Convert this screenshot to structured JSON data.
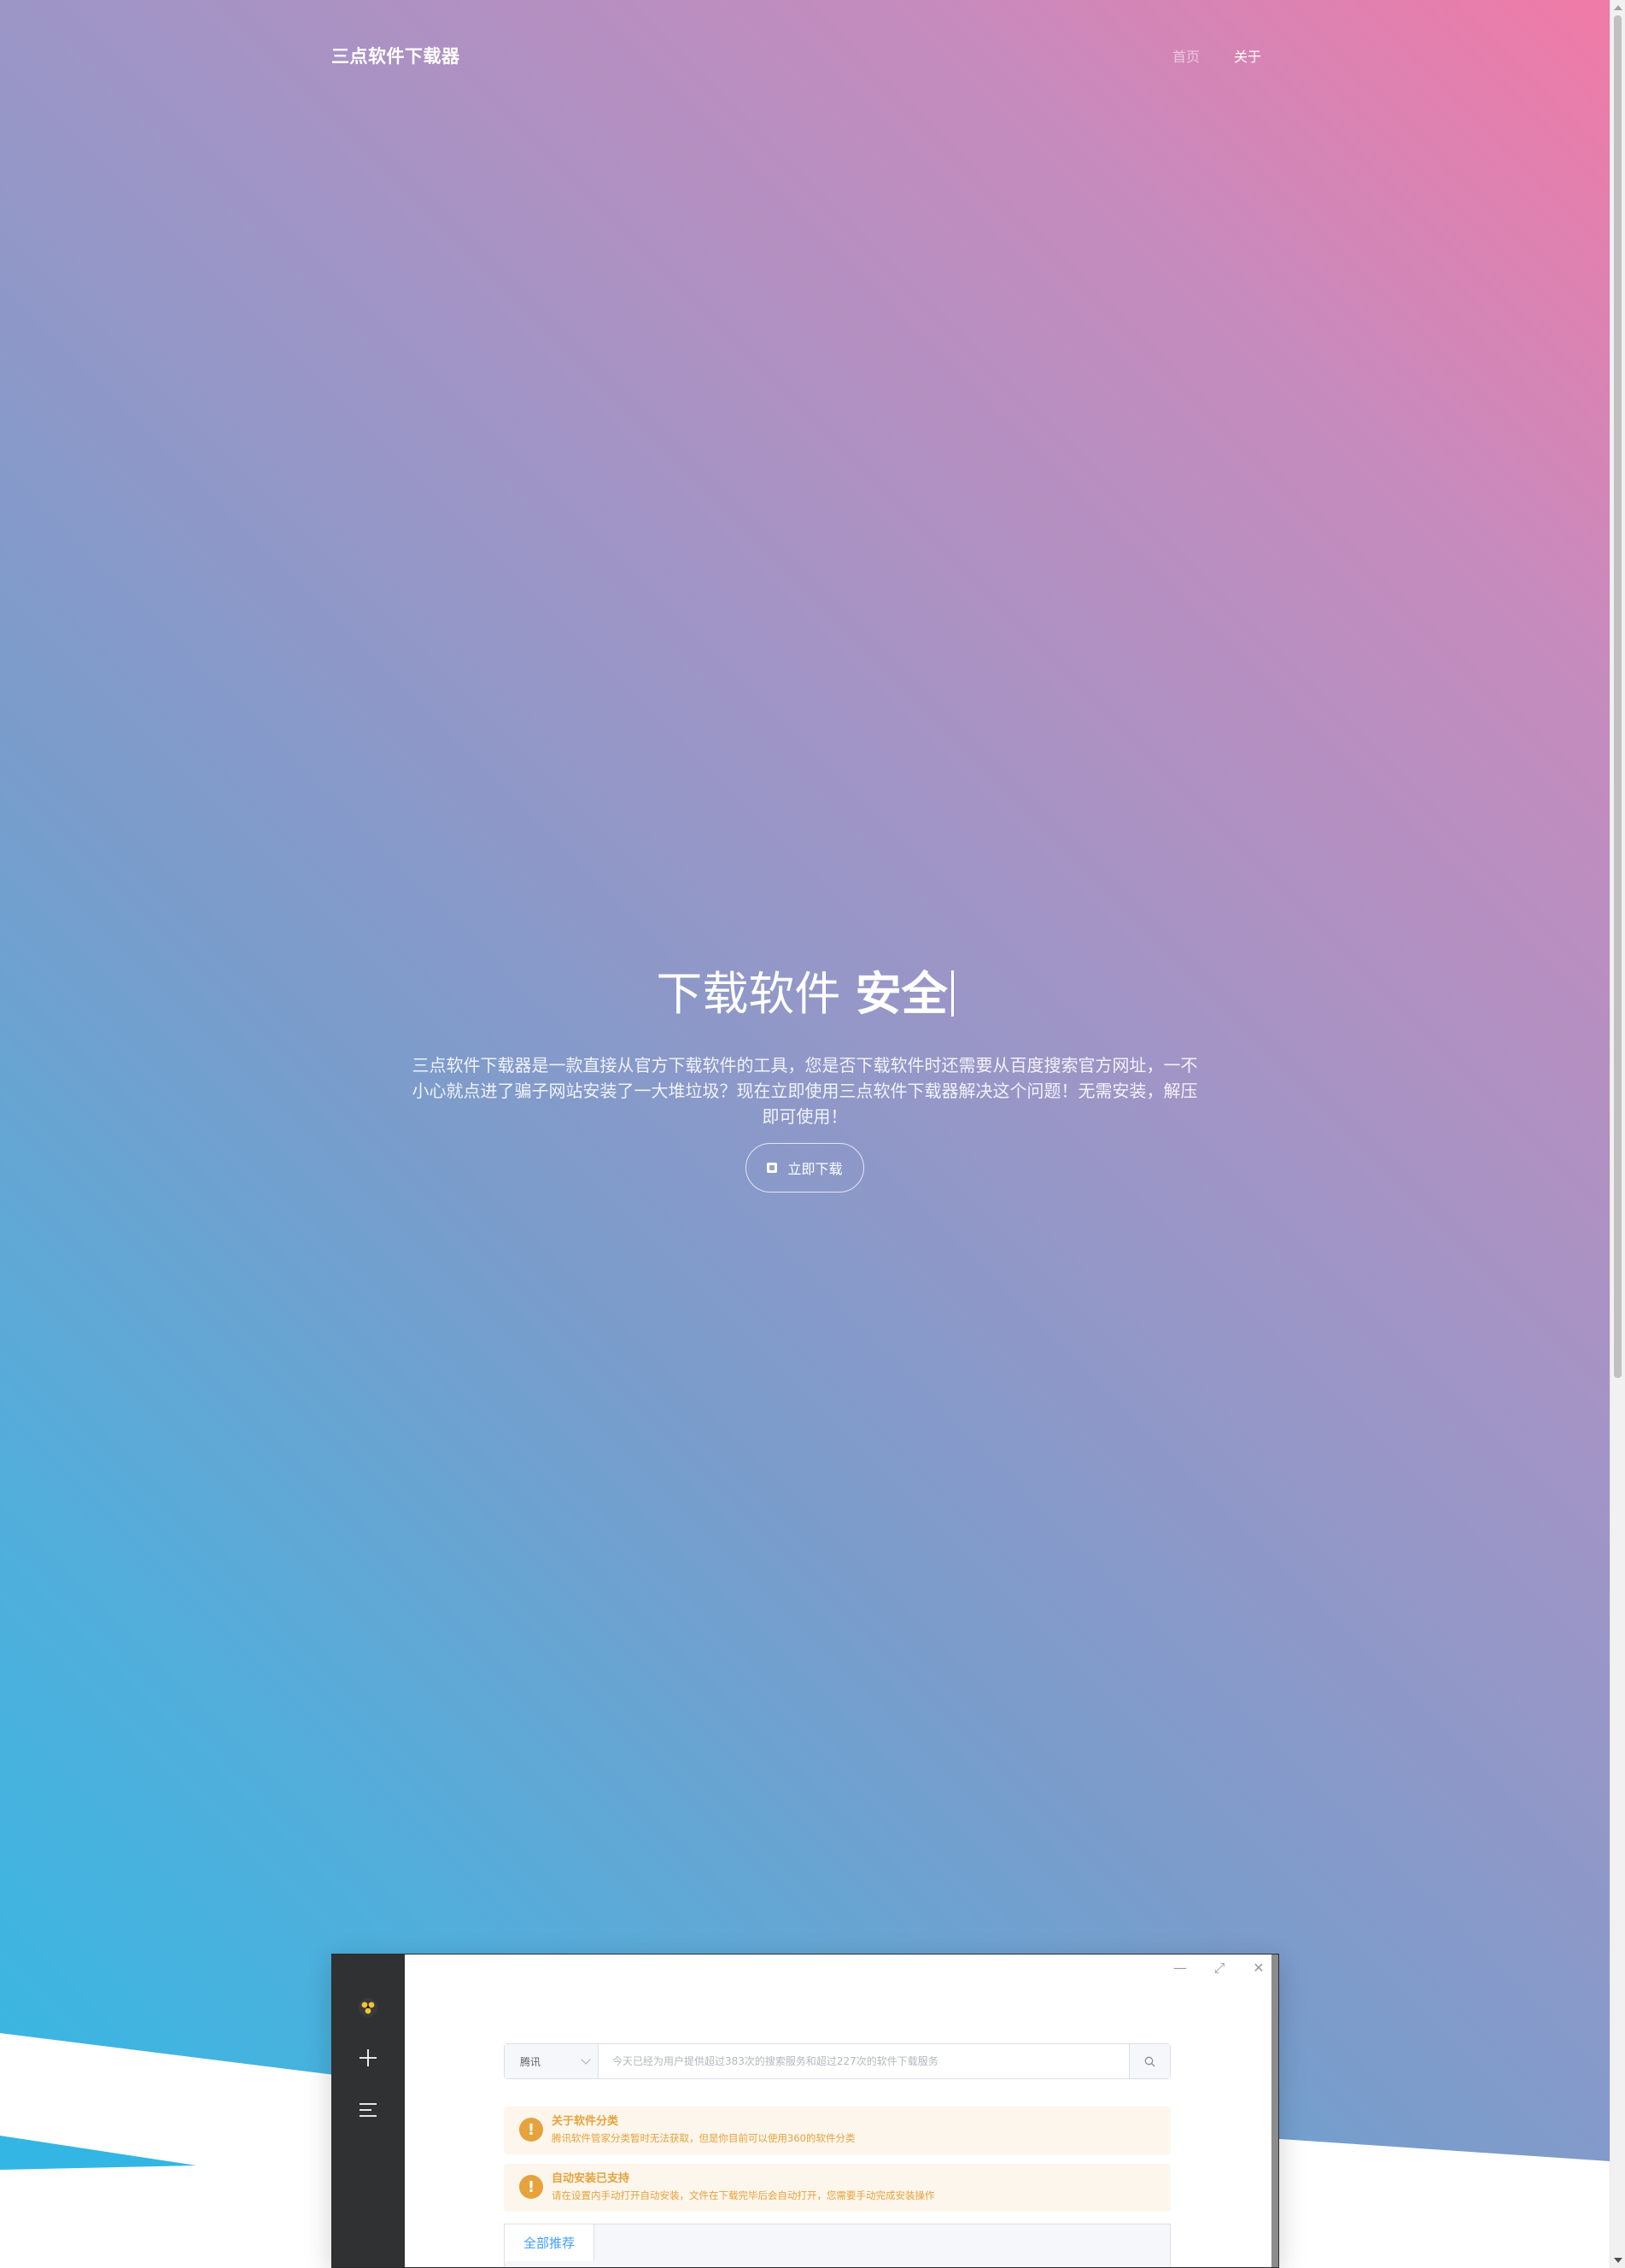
{
  "nav": {
    "brand": "三点软件下载器",
    "links": [
      {
        "label": "首页",
        "active": false
      },
      {
        "label": "关于",
        "active": true
      }
    ]
  },
  "hero": {
    "headline_prefix": "下载软件",
    "headline_typed": "安全",
    "description": "三点软件下载器是一款直接从官方下载软件的工具，您是否下载软件时还需要从百度搜索官方网址，一不小心就点进了骗子网站安装了一大堆垃圾？现在立即使用三点软件下载器解决这个问题！无需安装，解压即可使用！",
    "download_button": "立即下载"
  },
  "app_preview": {
    "window_controls": [
      "minimize-icon",
      "restore-icon",
      "close-icon"
    ],
    "sidebar_icons": [
      "app-logo-icon",
      "add-icon",
      "menu-icon"
    ],
    "search": {
      "source_selected": "腾讯",
      "placeholder": "今天已经为用户提供超过383次的搜索服务和超过227次的软件下载服务"
    },
    "alerts": [
      {
        "title": "关于软件分类",
        "description": "腾讯软件管家分类暂时无法获取，但是你目前可以使用360的软件分类"
      },
      {
        "title": "自动安装已支持",
        "description": "请在设置内手动打开自动安装，文件在下载完毕后会自动打开，您需要手动完成安装操作"
      }
    ],
    "tabs": [
      "全部推荐"
    ]
  },
  "colors": {
    "gradient_pink": "#f17aa6",
    "gradient_purple": "#9f95c6",
    "gradient_blue": "#32b9e4",
    "sidebar_dark": "#303133",
    "warning": "#e6a23c",
    "warning_bg": "#fdf6ec",
    "primary": "#409eff"
  }
}
